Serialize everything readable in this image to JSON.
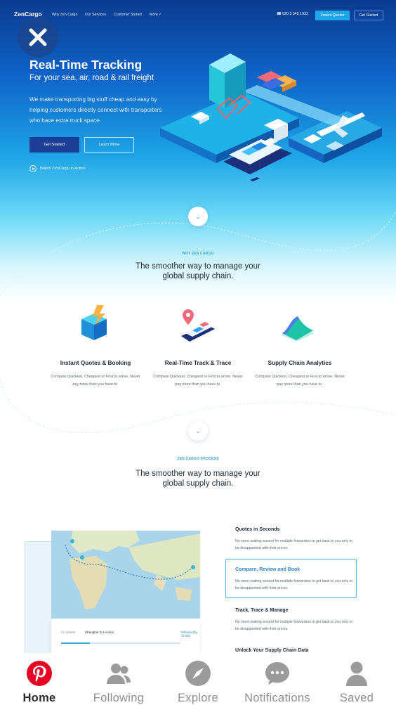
{
  "nav": {
    "logo": "ZenCargo",
    "links": [
      "Why Zen Cargo",
      "Our Services",
      "Customer Stories",
      "More"
    ],
    "phone": "020 3 342 1932",
    "quote_button": "Instant Quotes",
    "start_button": "Get Started"
  },
  "hero": {
    "title": "Real-Time Tracking",
    "subtitle": "For your sea, air, road & rail freight",
    "description": "We make transporting big stuff cheap and easy by helping customers directly connect with transporters who have extra truck space.",
    "primary_button": "Get Started",
    "secondary_button": "Learn More",
    "watch_link": "Watch ZenCargo in Action"
  },
  "why": {
    "eyebrow": "WHY ZEN CARGO",
    "title": "The smoother way to manage your global supply chain.",
    "features": [
      {
        "title": "Instant Quotes & Booking",
        "desc": "Compare Quickest, Cheapest or First to arrive. Never pay more than you have to."
      },
      {
        "title": "Real-Time Track & Trace",
        "desc": "Compare Quickest, Cheapest or First to arrive. Never pay more than you have to."
      },
      {
        "title": "Supply Chain Analytics",
        "desc": "Compare Quickest, Cheapest or First to arrive. Never pay more than you have to."
      }
    ]
  },
  "process": {
    "eyebrow": "ZEN CARGO PROCESS",
    "title": "The smoother way to manage your global supply chain.",
    "steps": [
      {
        "title": "Quotes in Seconds",
        "desc": "No more waiting around for multiple forwarders to get back to you only to be disappointed with their prices."
      },
      {
        "title": "Compare, Review and Book",
        "desc": "No more waiting around for multiple forwarders to get back to you only to be disappointed with their prices."
      },
      {
        "title": "Track, Trace & Manage",
        "desc": "No more waiting around for multiple forwarders to get back to you only to be disappointed with their prices."
      },
      {
        "title": "Unlock Your Supply Chain Data",
        "desc": ""
      }
    ],
    "shipment": {
      "id": "FU-66896",
      "route": "Shanghai to London",
      "delivery": "Delivered by 12 Mar",
      "progress": 0.24
    }
  },
  "tabbar": {
    "items": [
      {
        "label": "Home",
        "icon": "pinterest-icon",
        "active": true
      },
      {
        "label": "Following",
        "icon": "people-icon",
        "active": false
      },
      {
        "label": "Explore",
        "icon": "compass-icon",
        "active": false
      },
      {
        "label": "Notifications",
        "icon": "chat-icon",
        "active": false
      },
      {
        "label": "Saved",
        "icon": "person-icon",
        "active": false
      }
    ]
  },
  "colors": {
    "brand_red": "#e60023",
    "accent_blue": "#1da6ea",
    "navy": "#1e3f98"
  }
}
